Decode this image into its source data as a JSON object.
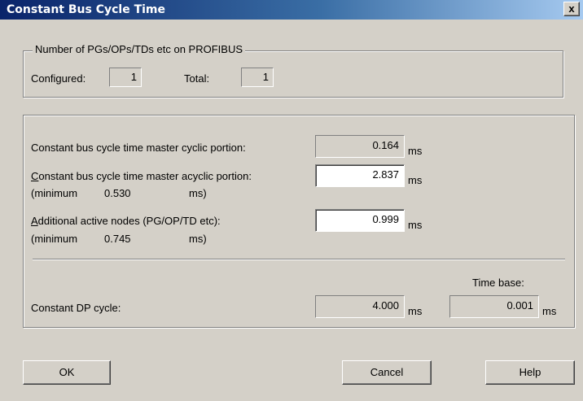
{
  "window": {
    "title": "Constant Bus Cycle Time",
    "close_label": "x"
  },
  "pg_group": {
    "legend": "Number of PGs/OPs/TDs etc on PROFIBUS",
    "configured_label": "Configured:",
    "configured_value": "1",
    "total_label": "Total:",
    "total_value": "1"
  },
  "cycle": {
    "cyclic_label": "Constant bus cycle time master cyclic portion:",
    "cyclic_value": "0.164",
    "cyclic_unit": "ms",
    "acyclic_label_key": "C",
    "acyclic_label_rest": "onstant bus cycle time master acyclic portion:",
    "acyclic_value": "2.837",
    "acyclic_unit": "ms",
    "acyclic_min_label": "(minimum",
    "acyclic_min_value": "0.530",
    "acyclic_min_unit": "ms)",
    "nodes_label_key": "A",
    "nodes_label_rest": "dditional active nodes (PG/OP/TD etc):",
    "nodes_value": "0.999",
    "nodes_unit": "ms",
    "nodes_min_label": "(minimum",
    "nodes_min_value": "0.745",
    "nodes_min_unit": "ms)",
    "timebase_label": "Time base:",
    "dp_label": "Constant DP cycle:",
    "dp_value": "4.000",
    "dp_unit": "ms",
    "timebase_value": "0.001",
    "timebase_unit": "ms"
  },
  "buttons": {
    "ok": "OK",
    "cancel": "Cancel",
    "help": "Help"
  }
}
